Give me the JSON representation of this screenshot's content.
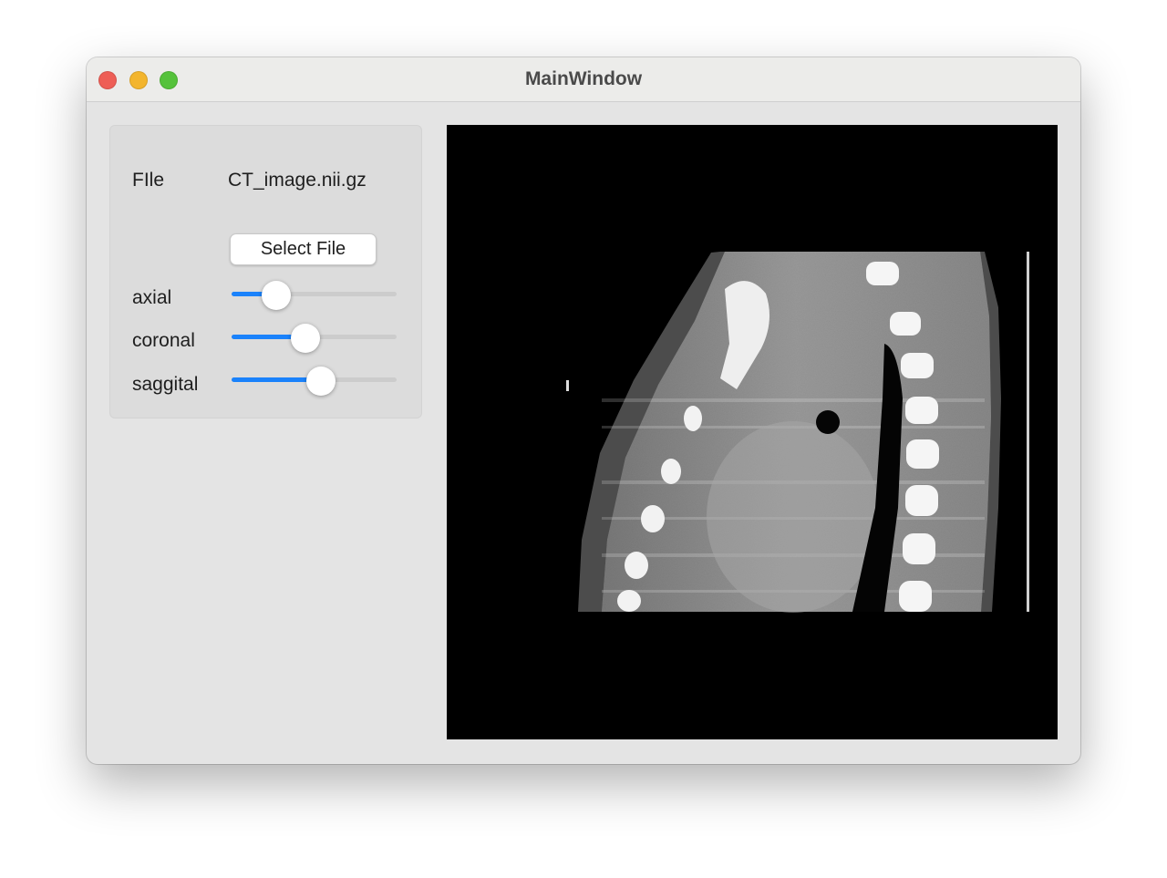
{
  "window": {
    "title": "MainWindow",
    "traffic_lights": [
      {
        "name": "close",
        "color": "#ee5e56"
      },
      {
        "name": "minimize",
        "color": "#f3b52d"
      },
      {
        "name": "zoom",
        "color": "#55c23b"
      }
    ]
  },
  "controls": {
    "file_label": "FIle",
    "file_value": "CT_image.nii.gz",
    "select_button": "Select File",
    "sliders": [
      {
        "label": "axial",
        "value_fraction": 0.27
      },
      {
        "label": "coronal",
        "value_fraction": 0.45
      },
      {
        "label": "saggital",
        "value_fraction": 0.54
      }
    ],
    "accent_color": "#1a82fb"
  },
  "viewer": {
    "background": "#000000",
    "content": "CT sagittal slice"
  }
}
